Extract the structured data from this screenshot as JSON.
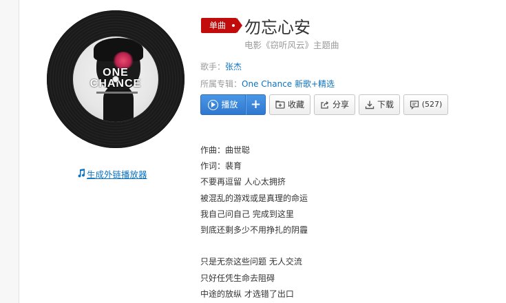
{
  "cover": {
    "line1": "ONE",
    "line2": "CHANCE"
  },
  "external_player_link": "生成外链播放器",
  "song": {
    "tag": "单曲",
    "title": "勿忘心安",
    "subtitle": "电影《窃听风云》主题曲"
  },
  "singer": {
    "label": "歌手：",
    "name": "张杰"
  },
  "album": {
    "label": "所属专辑：",
    "name": "One Chance 新歌+精选"
  },
  "toolbar": {
    "play_label": "播放",
    "add_label": "+",
    "favorite_label": "收藏",
    "share_label": "分享",
    "download_label": "下载",
    "comment_count": "(527)"
  },
  "lyrics": [
    "作曲：曲世聪",
    "作词：裴育",
    "不要再逗留 人心太拥挤",
    "被混乱的游戏或是真理的命运",
    "我自己问自己 完成到这里",
    "到底还剩多少不用挣扎的阴霾",
    "",
    "只是无奈这些问题 无人交流",
    "只好任凭生命去阻碍",
    "中途的放纵 才选错了出口"
  ],
  "colors": {
    "tag_red": "#c20c0c",
    "link_blue": "#0c73c2",
    "play_blue": "#2f78d0"
  }
}
